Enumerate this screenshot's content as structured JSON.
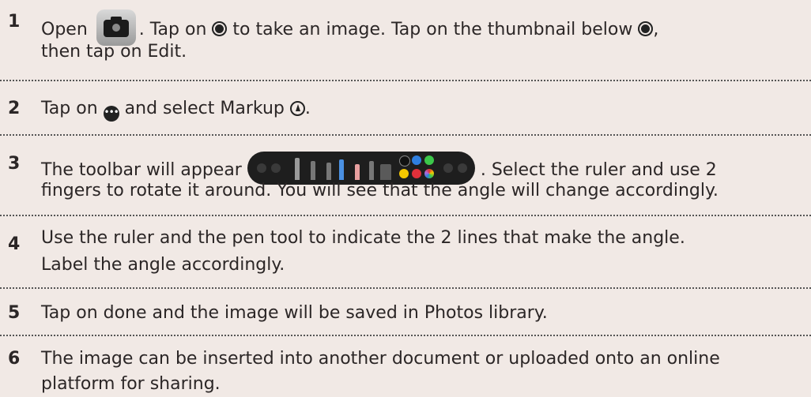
{
  "steps": [
    {
      "number": "1",
      "line1_part1": "Open",
      "line1_part2": ". Tap on",
      "line1_part3": "to take an image. Tap on the thumbnail below",
      "line1_part4": ",",
      "line2": "then tap on Edit."
    },
    {
      "number": "2",
      "part1": "Tap on",
      "part2": "and select Markup",
      "part3": "."
    },
    {
      "number": "3",
      "line1_part1": "The toolbar will appear",
      "line1_part2": ". Select the ruler and use 2",
      "line2": "fingers to rotate it around. You will see that the angle will change accordingly."
    },
    {
      "number": "4",
      "line1": "Use the ruler and the pen tool to indicate the 2 lines that make the angle.",
      "line2": "Label the angle accordingly."
    },
    {
      "number": "5",
      "line1": "Tap on done and the image will be saved in Photos library."
    },
    {
      "number": "6",
      "line1": "The image can be inserted into another document or uploaded onto an online",
      "line2": "platform for sharing."
    }
  ],
  "icons": {
    "camera_app": "camera-app-icon",
    "shutter": "shutter-button-icon",
    "more": "more-options-icon",
    "markup": "markup-icon",
    "toolbar": "markup-toolbar-image"
  },
  "colors": {
    "background": "#f1e9e5",
    "text": "#2b2626",
    "palette": [
      "#111111",
      "#2f7fe0",
      "#3cc74a",
      "#f5c800",
      "#e0303a",
      "#b36ad8"
    ]
  }
}
